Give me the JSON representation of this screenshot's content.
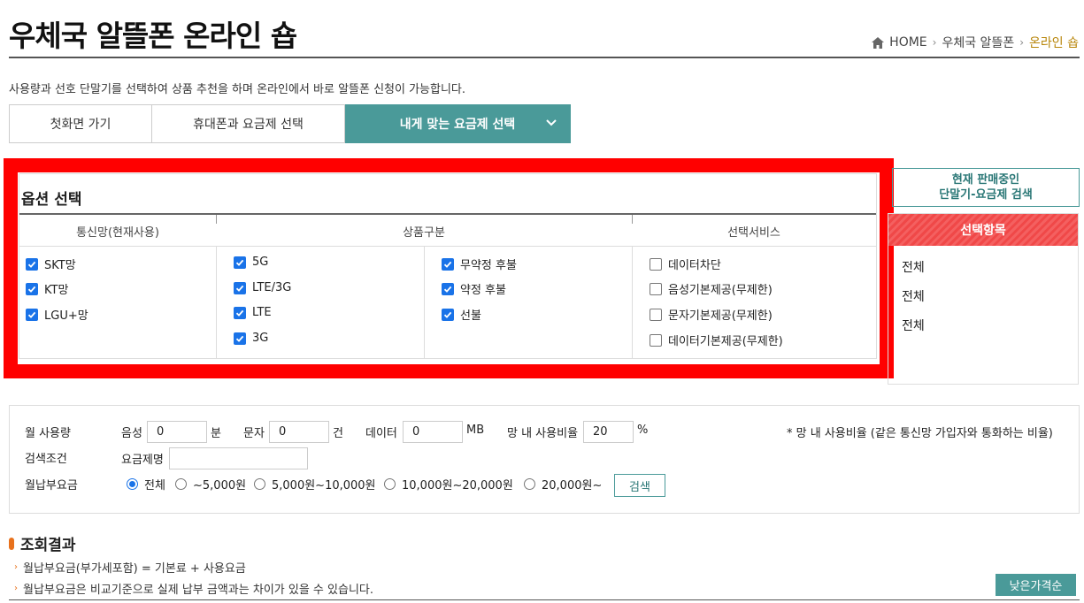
{
  "header": {
    "title": "우체국 알뜰폰 온라인 숍",
    "breadcrumb": [
      "HOME",
      "우체국 알뜰폰",
      "온라인 숍"
    ]
  },
  "intro": "사용량과 선호 단말기를 선택하여 상품 추천을 하며 온라인에서 바로 알뜰폰 신청이 가능합니다.",
  "steps": [
    "첫화면 가기",
    "휴대폰과 요금제 선택",
    "내게 맞는 요금제 선택"
  ],
  "options": {
    "title": "옵션 선택",
    "headers": [
      "통신망(현재사용)",
      "상품구분",
      "선택서비스"
    ],
    "network": [
      {
        "label": "SKT망",
        "checked": true
      },
      {
        "label": "KT망",
        "checked": true
      },
      {
        "label": "LGU+망",
        "checked": true
      }
    ],
    "tech": [
      {
        "label": "5G",
        "checked": true
      },
      {
        "label": "LTE/3G",
        "checked": true
      },
      {
        "label": "LTE",
        "checked": true
      },
      {
        "label": "3G",
        "checked": true
      }
    ],
    "payment": [
      {
        "label": "무약정 후불",
        "checked": true
      },
      {
        "label": "약정 후불",
        "checked": true
      },
      {
        "label": "선불",
        "checked": true
      }
    ],
    "services": [
      {
        "label": "데이터차단",
        "checked": false
      },
      {
        "label": "음성기본제공(무제한)",
        "checked": false
      },
      {
        "label": "문자기본제공(무제한)",
        "checked": false
      },
      {
        "label": "데이터기본제공(무제한)",
        "checked": false
      }
    ]
  },
  "side": {
    "search_button": [
      "현재 판매중인",
      "단말기-요금제 검색"
    ],
    "selected_header": "선택항목",
    "selected_items": [
      "전체",
      "전체",
      "전체"
    ]
  },
  "filter": {
    "usage_label": "월 사용량",
    "voice_label": "음성",
    "voice_value": "0",
    "voice_unit": "분",
    "sms_label": "문자",
    "sms_value": "0",
    "sms_unit": "건",
    "data_label": "데이터",
    "data_value": "0",
    "data_unit": "MB",
    "ratio_label": "망 내 사용비율",
    "ratio_value": "20",
    "ratio_unit": "%",
    "ratio_note": "* 망 내 사용비율 (같은 통신망 가입자와 통화하는 비율)",
    "cond_label": "검색조건",
    "plan_name_label": "요금제명",
    "plan_name_value": "",
    "fee_label": "월납부요금",
    "fee_options": [
      {
        "label": "전체",
        "selected": true
      },
      {
        "label": "~5,000원",
        "selected": false
      },
      {
        "label": "5,000원~10,000원",
        "selected": false
      },
      {
        "label": "10,000원~20,000원",
        "selected": false
      },
      {
        "label": "20,000원~",
        "selected": false
      }
    ],
    "search_label": "검색"
  },
  "results": {
    "title": "조회결과",
    "notes": [
      "월납부요금(부가세포함) = 기본료 + 사용요금",
      "월납부요금은 비교기준으로 실제 납부 금액과는 차이가 있을 수 있습니다."
    ],
    "low_price_label": "낮은가격순"
  },
  "colors": {
    "accent": "#4a9a99",
    "highlight": "#ff0000",
    "checkbox": "#1a73e8",
    "breadcrumb_current": "#b8860b"
  }
}
